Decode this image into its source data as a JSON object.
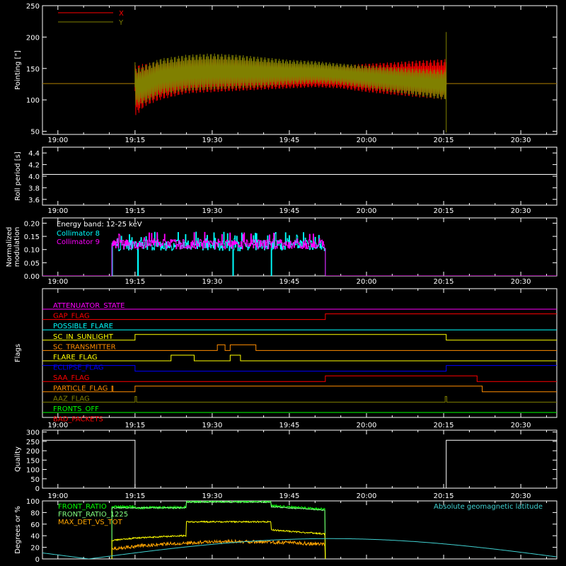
{
  "time_axis": {
    "ticks": [
      "19:00",
      "19:15",
      "19:30",
      "19:45",
      "20:00",
      "20:15",
      "20:30"
    ],
    "tick_minutes": [
      0,
      15,
      30,
      45,
      60,
      75,
      90
    ],
    "range_minutes": [
      -3,
      97
    ]
  },
  "chart_data": [
    {
      "type": "line",
      "id": "pointing",
      "ylabel": "Pointing [\"]",
      "ylim": [
        45,
        250
      ],
      "yticks": [
        50,
        100,
        150,
        200,
        250
      ],
      "grid": false,
      "legend_placement": "top-left",
      "series": [
        {
          "name": "X",
          "color": "#ff0000",
          "baseline": 126,
          "active_range": [
            15,
            75.5
          ],
          "envelope": [
            [
              15,
              73,
              155
            ],
            [
              17,
              90,
              158
            ],
            [
              20,
              100,
              162
            ],
            [
              25,
              110,
              166
            ],
            [
              30,
              112,
              168
            ],
            [
              35,
              114,
              166
            ],
            [
              40,
              116,
              162
            ],
            [
              45,
              118,
              158
            ],
            [
              50,
              120,
              155
            ],
            [
              55,
              118,
              155
            ],
            [
              60,
              112,
              158
            ],
            [
              65,
              108,
              160
            ],
            [
              70,
              104,
              163
            ],
            [
              75.5,
              100,
              165
            ]
          ],
          "oscillation_period_min": 1.4
        },
        {
          "name": "Y",
          "color": "#808000",
          "baseline": 126,
          "active_range": [
            15,
            75.5
          ],
          "envelope": [
            [
              15,
              90,
              150
            ],
            [
              17,
              95,
              156
            ],
            [
              20,
              108,
              166
            ],
            [
              25,
              114,
              172
            ],
            [
              30,
              116,
              174
            ],
            [
              35,
              118,
              172
            ],
            [
              40,
              120,
              168
            ],
            [
              45,
              124,
              164
            ],
            [
              50,
              126,
              162
            ],
            [
              55,
              124,
              158
            ],
            [
              60,
              118,
              155
            ],
            [
              65,
              112,
              152
            ],
            [
              70,
              106,
              150
            ],
            [
              75.5,
              100,
              148
            ]
          ],
          "oscillation_period_min": 1.4,
          "spikes": [
            {
              "x": 15,
              "y": 160
            },
            {
              "x": 75.5,
              "y": 208
            },
            {
              "x": 75.5,
              "y": 48
            }
          ]
        }
      ]
    },
    {
      "type": "line",
      "id": "roll_period",
      "ylabel": "Roll period [s]",
      "ylim": [
        3.5,
        4.5
      ],
      "yticks": [
        3.6,
        3.8,
        4.0,
        4.2,
        4.4
      ],
      "grid": false,
      "series": [
        {
          "color": "#ffffff",
          "x": [
            -3,
            97
          ],
          "y": [
            4.03,
            4.03
          ]
        }
      ]
    },
    {
      "type": "line",
      "id": "modulation",
      "ylabel": "Normalized modulation",
      "ylim": [
        0,
        0.22
      ],
      "yticks": [
        0.0,
        0.05,
        0.1,
        0.15,
        0.2
      ],
      "grid": false,
      "legend_placement": "top-left",
      "energy_band": "Energy band:  12-25 keV",
      "active_range": [
        10.5,
        52
      ],
      "series": [
        {
          "name": "Collimator 8",
          "color": "#00ffff",
          "mean": 0.115,
          "noise": 0.02,
          "dropouts": [
            10.5,
            15.5,
            34,
            41.5
          ]
        },
        {
          "name": "Collimator 9",
          "color": "#ff00ff",
          "mean": 0.12,
          "noise": 0.018
        }
      ]
    },
    {
      "type": "line",
      "id": "flags",
      "ylabel": "Flags",
      "grid": false,
      "series": [
        {
          "name": "ATTENUATOR_STATE",
          "color": "#ff00ff",
          "points": [
            [
              -3,
              0
            ],
            [
              97,
              0
            ]
          ]
        },
        {
          "name": "GAP_FLAG",
          "color": "#ff0000",
          "points": [
            [
              -3,
              0
            ],
            [
              52,
              0
            ],
            [
              52,
              1
            ],
            [
              97,
              1
            ]
          ]
        },
        {
          "name": "POSSIBLE_FLARE",
          "color": "#00ffff",
          "points": [
            [
              -3,
              0
            ],
            [
              97,
              0
            ]
          ]
        },
        {
          "name": "SC_IN_SUNLIGHT",
          "color": "#ffff00",
          "points": [
            [
              -3,
              0
            ],
            [
              15,
              0
            ],
            [
              15,
              1
            ],
            [
              75.5,
              1
            ],
            [
              75.5,
              0
            ],
            [
              97,
              0
            ]
          ]
        },
        {
          "name": "SC_TRANSMITTER",
          "color": "#ff8c00",
          "points": [
            [
              -3,
              0
            ],
            [
              31,
              0
            ],
            [
              31,
              1
            ],
            [
              32.5,
              1
            ],
            [
              32.5,
              0
            ],
            [
              33.5,
              0
            ],
            [
              33.5,
              1
            ],
            [
              38.5,
              1
            ],
            [
              38.5,
              0
            ],
            [
              97,
              0
            ]
          ]
        },
        {
          "name": "FLARE_FLAG",
          "color": "#ffff00",
          "points": [
            [
              -3,
              0
            ],
            [
              22,
              0
            ],
            [
              22,
              1
            ],
            [
              26.5,
              1
            ],
            [
              26.5,
              0
            ],
            [
              33.5,
              0
            ],
            [
              33.5,
              1
            ],
            [
              35.5,
              1
            ],
            [
              35.5,
              0
            ],
            [
              97,
              0
            ]
          ]
        },
        {
          "name": "ECLIPSE_FLAG",
          "color": "#0000ff",
          "points": [
            [
              -3,
              1
            ],
            [
              15,
              1
            ],
            [
              15,
              0
            ],
            [
              75.5,
              0
            ],
            [
              75.5,
              1
            ],
            [
              97,
              1
            ]
          ]
        },
        {
          "name": "SAA_FLAG",
          "color": "#ff0000",
          "points": [
            [
              -3,
              0
            ],
            [
              52,
              0
            ],
            [
              52,
              1
            ],
            [
              81.5,
              1
            ],
            [
              81.5,
              0
            ],
            [
              97,
              0
            ]
          ]
        },
        {
          "name": "PARTICLE_FLAG",
          "color": "#ff8c00",
          "points": [
            [
              -3,
              0
            ],
            [
              10.5,
              0
            ],
            [
              10.5,
              1
            ],
            [
              10.7,
              1
            ],
            [
              10.7,
              0
            ],
            [
              15,
              0
            ],
            [
              15,
              1
            ],
            [
              82.5,
              1
            ],
            [
              82.5,
              0
            ],
            [
              97,
              0
            ]
          ]
        },
        {
          "name": "AAZ_FLAG",
          "color": "#808000",
          "points": [
            [
              -3,
              0
            ],
            [
              15,
              0
            ],
            [
              15,
              1
            ],
            [
              15.3,
              1
            ],
            [
              15.3,
              0
            ],
            [
              75.3,
              0
            ],
            [
              75.3,
              1
            ],
            [
              75.6,
              1
            ],
            [
              75.6,
              0
            ],
            [
              97,
              0
            ]
          ]
        },
        {
          "name": "FRONTS_OFF",
          "color": "#00ff00",
          "points": [
            [
              -3,
              0
            ],
            [
              97,
              0
            ]
          ]
        },
        {
          "name": "BAD_PACKETS",
          "color": "#ff0000",
          "points": [
            [
              -3,
              0
            ],
            [
              97,
              0
            ]
          ]
        }
      ]
    },
    {
      "type": "line",
      "id": "quality",
      "ylabel": "Quality",
      "ylim": [
        0,
        310
      ],
      "yticks": [
        0,
        50,
        100,
        150,
        200,
        250,
        300
      ],
      "grid": false,
      "series": [
        {
          "color": "#ffffff",
          "points": [
            [
              -3,
              256
            ],
            [
              15,
              256
            ],
            [
              15,
              0
            ],
            [
              75.5,
              0
            ],
            [
              75.5,
              256
            ],
            [
              97,
              256
            ]
          ]
        }
      ]
    },
    {
      "type": "line",
      "id": "degrees",
      "ylabel": "Degrees or %",
      "ylim": [
        0,
        100
      ],
      "yticks": [
        0,
        20,
        40,
        60,
        80,
        100
      ],
      "grid": false,
      "legend_placement": "top-left",
      "series": [
        {
          "name": "FRONT_RATIO",
          "color": "#00ff00",
          "points": [
            [
              10.5,
              90
            ],
            [
              15,
              90
            ],
            [
              15,
              88
            ],
            [
              25,
              89
            ],
            [
              25,
              99
            ],
            [
              41.5,
              99
            ],
            [
              41.5,
              92
            ],
            [
              51,
              86
            ],
            [
              52,
              86
            ]
          ],
          "noise": 2
        },
        {
          "name": "FRONT_RATIO_1225",
          "color": "#80ff80",
          "points": [
            [
              10.5,
              88
            ],
            [
              15,
              88
            ],
            [
              25,
              88
            ],
            [
              25,
              98
            ],
            [
              41.5,
              98
            ],
            [
              41.5,
              90
            ],
            [
              52,
              84
            ]
          ],
          "noise": 1
        },
        {
          "name": "MAX_DET_VS_TOT",
          "color": "#ffa500",
          "points": [
            [
              10.5,
              17
            ],
            [
              15,
              22
            ],
            [
              25,
              28
            ],
            [
              35,
              30
            ],
            [
              45,
              28
            ],
            [
              52,
              25
            ]
          ],
          "noise": 3
        },
        {
          "color": "#ffff00",
          "points": [
            [
              10.5,
              32
            ],
            [
              15,
              36
            ],
            [
              24,
              40
            ],
            [
              25,
              40
            ],
            [
              25,
              64
            ],
            [
              41.5,
              64
            ],
            [
              41.5,
              50
            ],
            [
              52,
              43
            ]
          ],
          "noise": 1.2
        },
        {
          "name": "Absolute geomagnetic latitude",
          "color": "#40d0d0",
          "curve": {
            "min": 0,
            "max": 35,
            "troughs": [
              6,
              53
            ]
          }
        }
      ]
    }
  ]
}
